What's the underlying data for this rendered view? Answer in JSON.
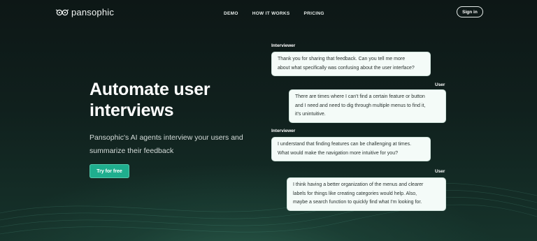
{
  "nav": {
    "logo_text": "pansophic",
    "links": [
      "DEMO",
      "HOW IT WORKS",
      "PRICING"
    ],
    "signin_label": "Sign in"
  },
  "hero": {
    "title_line1": "Automate user",
    "title_line2": "interviews",
    "subtitle": "Pansophic's AI agents interview your users and summarize their feedback",
    "cta_label": "Try for free"
  },
  "conversation": [
    {
      "speaker": "Interviewer",
      "lines": [
        "Thank you for sharing that feedback. Can you tell me more",
        "about what specifically was confusing about the user interface?"
      ]
    },
    {
      "speaker": "User",
      "lines": [
        "There are times where I can't find a certain feature or button",
        "and I need and need to dig through multiple menus to find it,",
        "it's unintuitive."
      ]
    },
    {
      "speaker": "Interviewer",
      "lines": [
        "I understand that finding features can be challenging at times.",
        "What would make the navigation more intuitive for you?"
      ]
    },
    {
      "speaker": "User",
      "lines": [
        "I think having a better organization of the menus and clearer",
        "labels for things like creating categories would help. Also,",
        "maybe a search function to quickly find what I'm looking for."
      ]
    }
  ],
  "colors": {
    "accent": "#1fae8e",
    "background": "#10201d",
    "bubble": "#f4fbf8"
  }
}
